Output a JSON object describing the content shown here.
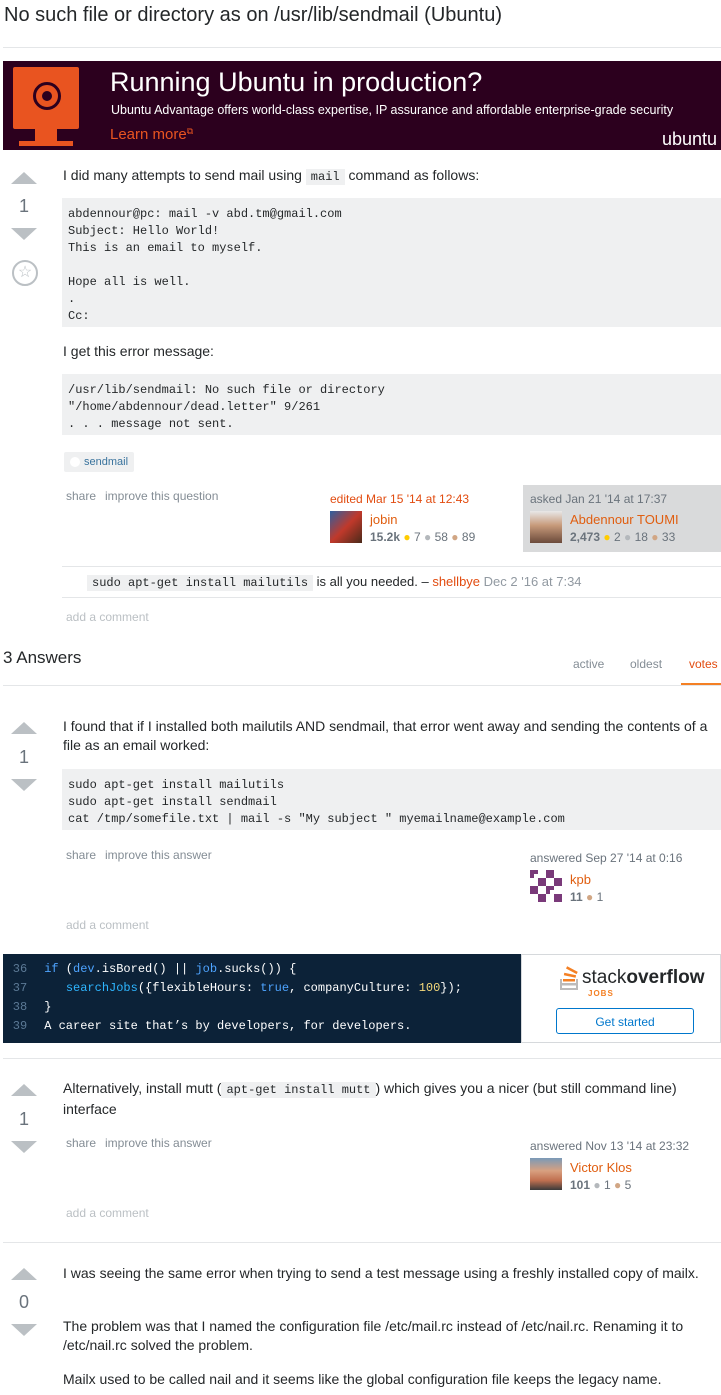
{
  "page_title": "No such file or directory as on /usr/lib/sendmail (Ubuntu)",
  "ad": {
    "headline": "Running Ubuntu in production?",
    "subtext": "Ubuntu Advantage offers world-class expertise, IP assurance and affordable enterprise-grade security",
    "cta": "Learn more",
    "brand": "ubuntu",
    "colors": {
      "background": "#2c001e",
      "accent": "#e95420"
    }
  },
  "question": {
    "votes": "1",
    "intro_before": "I did many attempts to send mail using",
    "intro_code": "mail",
    "intro_after": "command as follows:",
    "code1": "abdennour@pc: mail -v abd.tm@gmail.com\nSubject: Hello World!\nThis is an email to myself.\n\nHope all is well.\n.\nCc:",
    "error_intro": "I get this error message:",
    "code2": "/usr/lib/sendmail: No such file or directory\n\"/home/abdennour/dead.letter\" 9/261\n. . . message not sent.",
    "tag": "sendmail",
    "share": "share",
    "improve": "improve this question",
    "edited": {
      "time": "edited Mar 15 '14 at 12:43",
      "user": "jobin",
      "rep": "15.2k",
      "gold": "7",
      "silver": "58",
      "bronze": "89"
    },
    "asked": {
      "time": "asked Jan 21 '14 at 17:37",
      "user": "Abdennour TOUMI",
      "rep": "2,473",
      "gold": "2",
      "silver": "18",
      "bronze": "33"
    },
    "comment": {
      "code": "sudo apt-get install mailutils",
      "text": "is all you needed. –",
      "user": "shellbye",
      "time": "Dec 2 '16 at 7:34"
    },
    "add_comment": "add a comment"
  },
  "answers_header": {
    "count": "3 Answers",
    "tabs": [
      "active",
      "oldest",
      "votes"
    ],
    "active_tab": "votes"
  },
  "answers": [
    {
      "votes": "1",
      "text": "I found that if I installed both mailutils AND sendmail, that error went away and sending the contents of a file as an email worked:",
      "code": "sudo apt-get install mailutils\nsudo apt-get install sendmail\ncat /tmp/somefile.txt | mail -s \"My subject \" myemailname@example.com",
      "share": "share",
      "improve": "improve this answer",
      "answered": {
        "time": "answered Sep 27 '14 at 0:16",
        "user": "kpb",
        "rep": "11",
        "bronze": "1"
      },
      "add_comment": "add a comment"
    },
    {
      "votes": "1",
      "text_before": "Alternatively, install mutt (",
      "code_inline": "apt-get install mutt",
      "text_after": ") which gives you a nicer (but still command line) interface",
      "share": "share",
      "improve": "improve this answer",
      "answered": {
        "time": "answered Nov 13 '14 at 23:32",
        "user": "Victor Klos",
        "rep": "101",
        "silver": "1",
        "bronze": "5"
      },
      "add_comment": "add a comment"
    },
    {
      "votes": "0",
      "p1": "I was seeing the same error when trying to send a test message using a freshly installed copy of mailx.",
      "p2": "The problem was that I named the configuration file /etc/mail.rc instead of /etc/nail.rc. Renaming it to /etc/nail.rc solved the problem.",
      "p3": "Mailx used to be called nail and it seems like the global configuration file keeps the legacy name."
    }
  ],
  "jobs_ad": {
    "lines": [
      {
        "n": "36"
      },
      {
        "n": "37"
      },
      {
        "n": "38",
        "text": "}"
      },
      {
        "n": "39",
        "text": "A career site that’s by developers, for developers."
      }
    ],
    "code": {
      "if": "if",
      "open": " (",
      "dev": "dev",
      "isBored": ".isBored() || ",
      "job": "job",
      "sucks": ".sucks()) {",
      "searchJobs": "searchJobs",
      "args1": "({flexibleHours: ",
      "true": "true",
      "args2": ", companyCulture: ",
      "hundred": "100",
      "args3": "});"
    },
    "logo_a": "stack",
    "logo_b": "overflow",
    "logo_sub": "JOBS",
    "button": "Get started"
  }
}
